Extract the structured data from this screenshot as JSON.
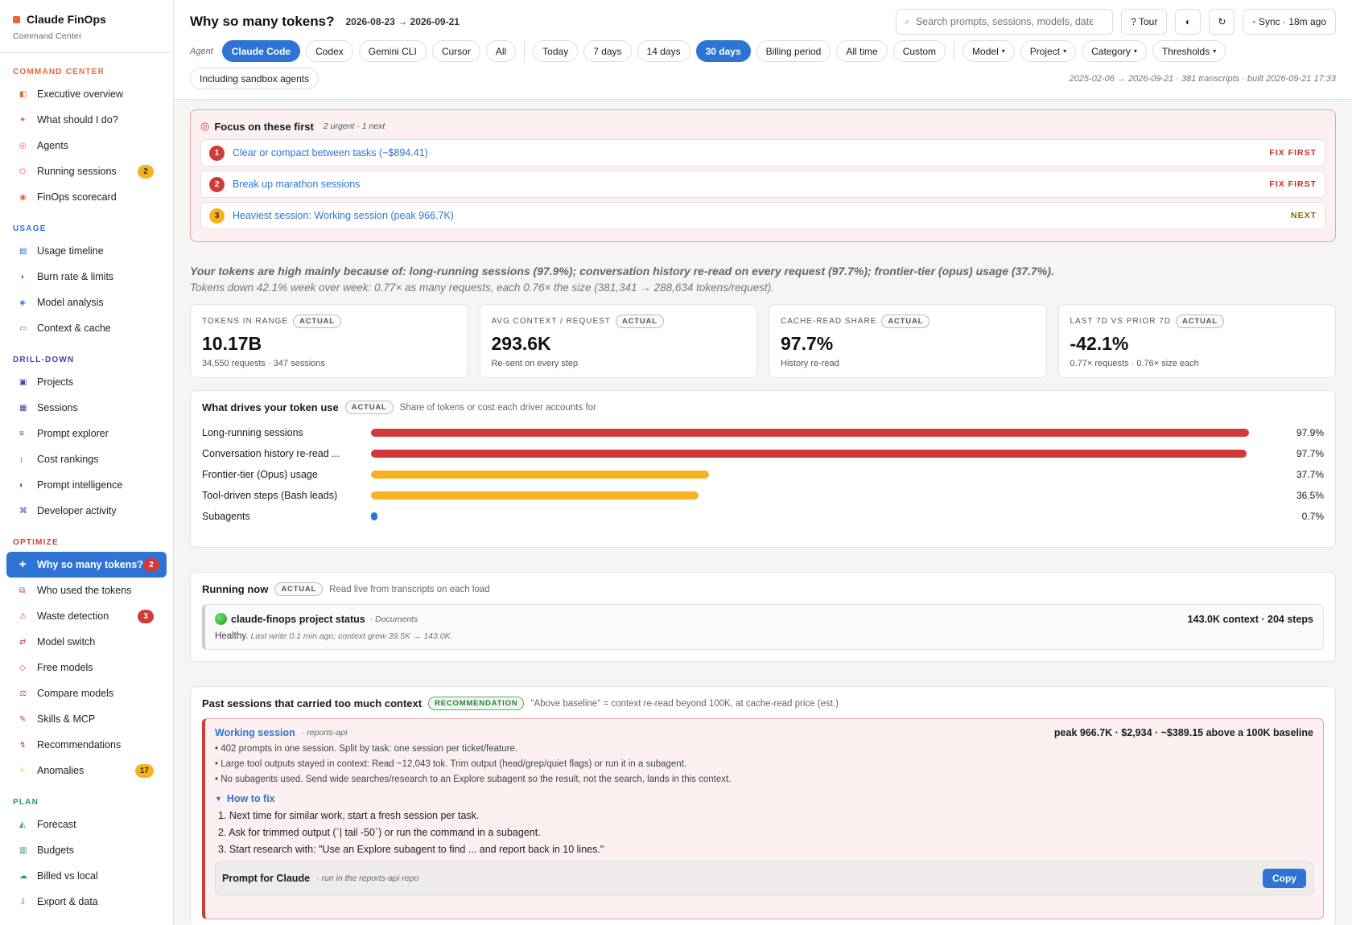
{
  "brand": {
    "title": "Claude FinOps",
    "subtitle": "Command Center"
  },
  "nav": [
    {
      "section": "COMMAND CENTER",
      "color": "#e8663a",
      "items": [
        {
          "label": "Executive overview",
          "icon": "◧",
          "icon_name": "overview-icon",
          "icon_color": "#e8663a"
        },
        {
          "label": "What should I do?",
          "icon": "✦",
          "icon_name": "sparkle-icon",
          "icon_color": "#e8663a"
        },
        {
          "label": "Agents",
          "icon": "◎",
          "icon_name": "agents-icon",
          "icon_color": "#e8663a"
        },
        {
          "label": "Running sessions",
          "icon": "⏻",
          "icon_name": "running-icon",
          "icon_color": "#e8663a",
          "badge": "2",
          "badge_style": "amber"
        },
        {
          "label": "FinOps scorecard",
          "icon": "◉",
          "icon_name": "scorecard-icon",
          "icon_color": "#e8663a"
        }
      ]
    },
    {
      "section": "USAGE",
      "color": "#2f73d4",
      "items": [
        {
          "label": "Usage timeline",
          "icon": "▤",
          "icon_name": "timeline-icon",
          "icon_color": "#2f73d4"
        },
        {
          "label": "Burn rate & limits",
          "icon": "◑",
          "icon_name": "burn-rate-icon",
          "icon_color": "#2f73d4"
        },
        {
          "label": "Model analysis",
          "icon": "◈",
          "icon_name": "model-analysis-icon",
          "icon_color": "#2f73d4"
        },
        {
          "label": "Context & cache",
          "icon": "▭",
          "icon_name": "context-cache-icon",
          "icon_color": "#2f73d4"
        }
      ]
    },
    {
      "section": "DRILL-DOWN",
      "color": "#4a3fb0",
      "items": [
        {
          "label": "Projects",
          "icon": "▣",
          "icon_name": "projects-icon",
          "icon_color": "#4a3fb0"
        },
        {
          "label": "Sessions",
          "icon": "▦",
          "icon_name": "sessions-icon",
          "icon_color": "#4a3fb0"
        },
        {
          "label": "Prompt explorer",
          "icon": "≡",
          "icon_name": "prompt-explorer-icon",
          "icon_color": "#4a3fb0"
        },
        {
          "label": "Cost rankings",
          "icon": "↕",
          "icon_name": "cost-rankings-icon",
          "icon_color": "#4a3fb0"
        },
        {
          "label": "Prompt intelligence",
          "icon": "◐",
          "icon_name": "prompt-intelligence-icon",
          "icon_color": "#4a3fb0"
        },
        {
          "label": "Developer activity",
          "icon": "⌘",
          "icon_name": "developer-activity-icon",
          "icon_color": "#4a3fb0"
        }
      ]
    },
    {
      "section": "OPTIMIZE",
      "color": "#d23a3a",
      "items": [
        {
          "label": "Why so many tokens?",
          "icon": "✚",
          "icon_name": "tokens-icon",
          "icon_color": "#ffffff",
          "badge": "2",
          "badge_style": "red",
          "active": true
        },
        {
          "label": "Who used the tokens",
          "icon": "⧉",
          "icon_name": "who-used-icon",
          "icon_color": "#d23a3a"
        },
        {
          "label": "Waste detection",
          "icon": "⚠",
          "icon_name": "warning-icon",
          "icon_color": "#d23a3a",
          "badge": "3",
          "badge_style": "red"
        },
        {
          "label": "Model switch",
          "icon": "⇄",
          "icon_name": "model-switch-icon",
          "icon_color": "#d23a3a"
        },
        {
          "label": "Free models",
          "icon": "◇",
          "icon_name": "free-models-icon",
          "icon_color": "#d23a3a"
        },
        {
          "label": "Compare models",
          "icon": "⚖",
          "icon_name": "compare-models-icon",
          "icon_color": "#d23a3a"
        },
        {
          "label": "Skills & MCP",
          "icon": "✎",
          "icon_name": "skills-icon",
          "icon_color": "#d23a3a"
        },
        {
          "label": "Recommendations",
          "icon": "↯",
          "icon_name": "recommendations-icon",
          "icon_color": "#d23a3a"
        },
        {
          "label": "Anomalies",
          "icon": "⚡",
          "icon_name": "lightning-icon",
          "icon_color": "#f5b324",
          "badge": "17",
          "badge_style": "amber"
        }
      ]
    },
    {
      "section": "PLAN",
      "color": "#2c9a5c",
      "items": [
        {
          "label": "Forecast",
          "icon": "◭",
          "icon_name": "forecast-icon",
          "icon_color": "#2c9a5c"
        },
        {
          "label": "Budgets",
          "icon": "▥",
          "icon_name": "budgets-icon",
          "icon_color": "#2c9a5c"
        },
        {
          "label": "Billed vs local",
          "icon": "☁",
          "icon_name": "cloud-icon",
          "icon_color": "#2c9a5c"
        },
        {
          "label": "Export & data",
          "icon": "⇩",
          "icon_name": "export-icon",
          "icon_color": "#2c9a5c"
        }
      ]
    }
  ],
  "header": {
    "title": "Why so many tokens?",
    "date_range": "2026-08-23 → 2026-09-21",
    "search_placeholder": "Search prompts, sessions, models, dates",
    "tour": "? Tour",
    "theme_icon": "◐",
    "refresh_icon": "↻",
    "sync": "◦ Sync · 18m ago"
  },
  "filters": {
    "agent_label": "Agent",
    "agents": [
      {
        "label": "Claude Code",
        "active": true
      },
      {
        "label": "Codex"
      },
      {
        "label": "Gemini CLI"
      },
      {
        "label": "Cursor"
      },
      {
        "label": "All"
      }
    ],
    "ranges": [
      {
        "label": "Today"
      },
      {
        "label": "7 days"
      },
      {
        "label": "14 days"
      },
      {
        "label": "30 days",
        "active": true
      },
      {
        "label": "Billing period"
      },
      {
        "label": "All time"
      },
      {
        "label": "Custom"
      }
    ],
    "dropdowns": [
      "Model",
      "Project",
      "Category",
      "Thresholds"
    ],
    "sandbox": "Including sandbox agents",
    "meta": "2025-02-06 → 2026-09-21 · 381 transcripts · built 2026-09-21 17:33"
  },
  "focus": {
    "title": "Focus on these first",
    "sub": "2 urgent · 1 next",
    "items": [
      {
        "num": "1",
        "text": "Clear or compact between tasks (~$894.41)",
        "tag": "FIX FIRST",
        "style": "red"
      },
      {
        "num": "2",
        "text": "Break up marathon sessions",
        "tag": "FIX FIRST",
        "style": "red"
      },
      {
        "num": "3",
        "text": "Heaviest session: Working session (peak 966.7K)",
        "tag": "NEXT",
        "style": "amber"
      }
    ]
  },
  "summary": {
    "line1": "Your tokens are high mainly because of: long-running sessions (97.9%); conversation history re-read on every request (97.7%); frontier-tier (opus) usage (37.7%).",
    "line2": "Tokens down 42.1% week over week: 0.77× as many requests, each 0.76× the size (381,341 → 288,634 tokens/request)."
  },
  "kpis": [
    {
      "label": "TOKENS IN RANGE",
      "pill": "ACTUAL",
      "value": "10.17B",
      "sub": "34,550 requests · 347 sessions"
    },
    {
      "label": "AVG CONTEXT / REQUEST",
      "pill": "ACTUAL",
      "value": "293.6K",
      "sub": "Re-sent on every step"
    },
    {
      "label": "CACHE-READ SHARE",
      "pill": "ACTUAL",
      "value": "97.7%",
      "sub": "History re-read"
    },
    {
      "label": "LAST 7D VS PRIOR 7D",
      "pill": "ACTUAL",
      "value": "-42.1%",
      "sub": "0.77× requests · 0.76× size each"
    }
  ],
  "drivers": {
    "title": "What drives your token use",
    "pill": "ACTUAL",
    "note": "Share of tokens or cost each driver accounts for"
  },
  "chart_data": {
    "type": "bar",
    "orientation": "horizontal",
    "categories": [
      "Long-running sessions",
      "Conversation history re-read ...",
      "Frontier-tier (Opus) usage",
      "Tool-driven steps (Bash leads)",
      "Subagents"
    ],
    "values": [
      97.9,
      97.7,
      37.7,
      36.5,
      0.7
    ],
    "labels": [
      "97.9%",
      "97.7%",
      "37.7%",
      "36.5%",
      "0.7%"
    ],
    "colors": [
      "#d23a3a",
      "#d23a3a",
      "#f5b324",
      "#f5b324",
      "#2f73d4"
    ],
    "xlim": [
      0,
      100
    ]
  },
  "running": {
    "title": "Running now",
    "pill": "ACTUAL",
    "note": "Read live from transcripts on each load",
    "item": {
      "name": "claude-finops project status",
      "project": "· Documents",
      "stats": "143.0K context · 204 steps",
      "status": "Healthy.",
      "detail": "Last write 0.1 min ago; context grew 39.5K → 143.0K."
    }
  },
  "past": {
    "title": "Past sessions that carried too much context",
    "pill": "RECOMMENDATION",
    "note": "\"Above baseline\" = context re-read beyond 100K, at cache-read price (est.)",
    "session": {
      "name": "Working session",
      "project": "· reports-api",
      "stats": "peak 966.7K · $2,934 · ~$389.15 above a 100K baseline",
      "bullets": [
        "• 402 prompts in one session. Split by task: one session per ticket/feature.",
        "• Large tool outputs stayed in context: Read ~12,043 tok. Trim output (head/grep/quiet flags) or run it in a subagent.",
        "• No subagents used. Send wide searches/research to an Explore subagent so the result, not the search, lands in this context."
      ],
      "howto": "How to fix",
      "steps": [
        "1. Next time for similar work, start a fresh session per task.",
        "2. Ask for trimmed output (`| tail -50`) or run the command in a subagent.",
        "3. Start research with: \"Use an Explore subagent to find ... and report back in 10 lines.\""
      ],
      "prompt_title": "Prompt for Claude",
      "prompt_note": "· run in the reports-api repo",
      "copy": "Copy"
    }
  }
}
